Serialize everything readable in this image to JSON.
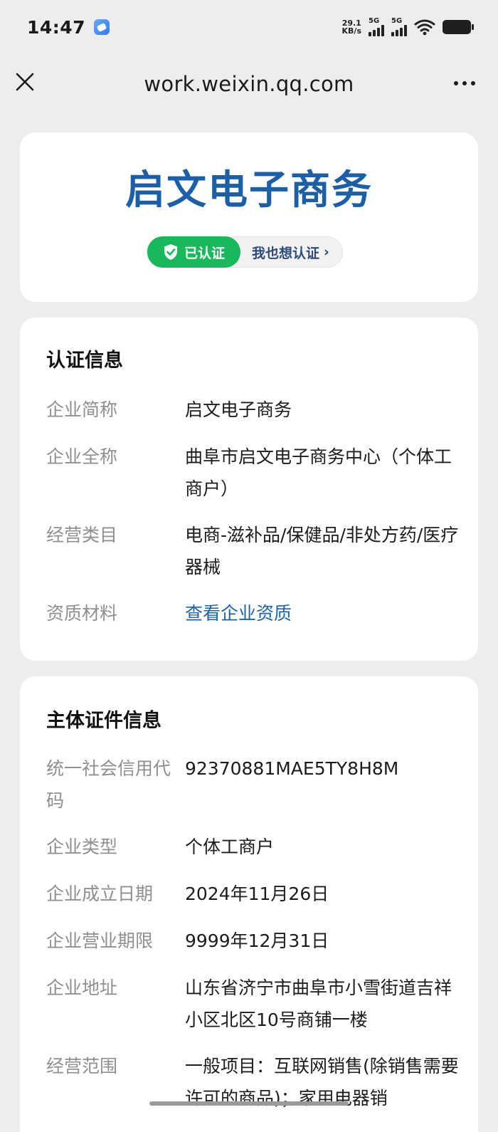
{
  "status": {
    "time": "14:47",
    "netspeed_value": "29.1",
    "netspeed_unit": "KB/s",
    "sim1_label": "5G",
    "sim2_label": "5G"
  },
  "nav": {
    "title": "work.weixin.qq.com"
  },
  "header": {
    "company_name": "启文电子商务",
    "verified_label": "已认证",
    "want_verify_label": "我也想认证",
    "want_verify_chevron": "›"
  },
  "cert_info": {
    "title": "认证信息",
    "rows": [
      {
        "label": "企业简称",
        "value": "启文电子商务"
      },
      {
        "label": "企业全称",
        "value": "曲阜市启文电子商务中心（个体工商户）"
      },
      {
        "label": "经营类目",
        "value": "电商-滋补品/保健品/非处方药/医疗器械"
      },
      {
        "label": "资质材料",
        "value": "查看企业资质"
      }
    ]
  },
  "subject_info": {
    "title": "主体证件信息",
    "rows": [
      {
        "label": "统一社会信用代码",
        "value": "92370881MAE5TY8H8M"
      },
      {
        "label": "企业类型",
        "value": "个体工商户"
      },
      {
        "label": "企业成立日期",
        "value": "2024年11月26日"
      },
      {
        "label": "企业营业期限",
        "value": "9999年12月31日"
      },
      {
        "label": "企业地址",
        "value": "山东省济宁市曲阜市小雪街道吉祥小区北区10号商铺一楼"
      },
      {
        "label": "经营范围",
        "value": "一般项目：互联网销售(除销售需要许可的商品)；家用电器销"
      }
    ]
  },
  "colors": {
    "brand_blue": "#1a5fa8",
    "verified_green": "#18b95b",
    "link_blue": "#1b62ad"
  }
}
